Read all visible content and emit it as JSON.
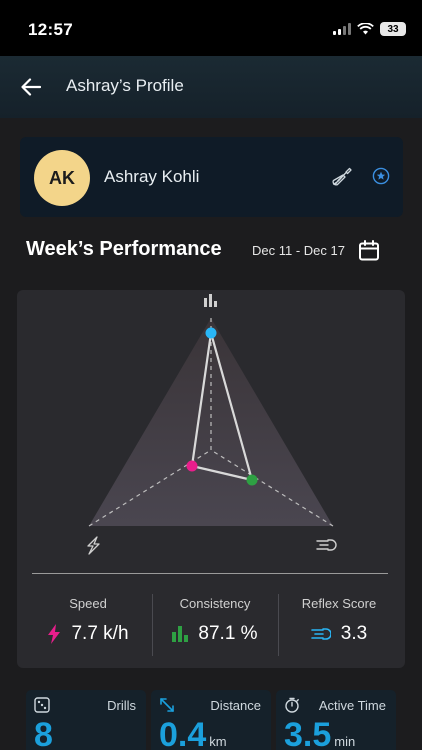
{
  "status_bar": {
    "time": "12:57",
    "battery": "33"
  },
  "app_bar": {
    "title": "Ashray’s Profile"
  },
  "profile": {
    "initials": "AK",
    "name": "Ashray Kohli"
  },
  "performance": {
    "title": "Week’s Performance",
    "date_range": "Dec 11 - Dec 17"
  },
  "chart_data": {
    "type": "radar",
    "axes": [
      "Consistency",
      "Speed",
      "Reflex Score"
    ],
    "values": {
      "Consistency": 87.1,
      "Speed": 7.7,
      "Reflex Score": 3.3
    },
    "colors": {
      "consistency": "#29b6f6",
      "speed": "#e91e8c",
      "reflex": "#2ea043",
      "line": "#d9d9d9"
    }
  },
  "metrics": [
    {
      "label": "Speed",
      "value": "7.7 k/h",
      "icon": "lightning-icon",
      "color": "#e91e8c"
    },
    {
      "label": "Consistency",
      "value": "87.1 %",
      "icon": "bar-chart-icon",
      "color": "#2ea043"
    },
    {
      "label": "Reflex Score",
      "value": "3.3",
      "icon": "speed-lines-icon",
      "color": "#29b6f6"
    }
  ],
  "tiles": [
    {
      "label": "Drills",
      "value": "8",
      "unit": "",
      "icon": "dice-icon"
    },
    {
      "label": "Distance",
      "value": "0.4",
      "unit": "km",
      "icon": "diagonal-arrows-icon"
    },
    {
      "label": "Active Time",
      "value": "3.5",
      "unit": "min",
      "icon": "timer-icon"
    }
  ]
}
